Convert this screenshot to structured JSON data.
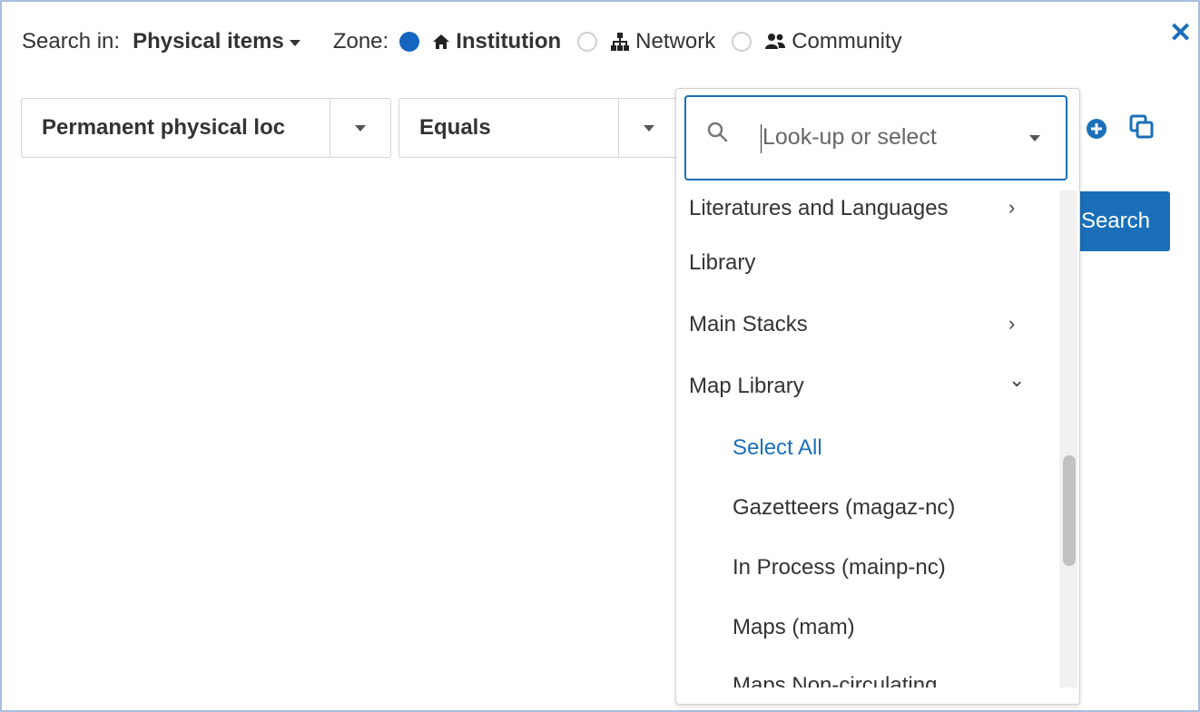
{
  "header": {
    "search_in_label": "Search in:",
    "search_scope": "Physical items",
    "zone_label": "Zone:",
    "zones": [
      {
        "label": "Institution",
        "selected": true,
        "icon": "home-icon"
      },
      {
        "label": "Network",
        "selected": false,
        "icon": "network-icon"
      },
      {
        "label": "Community",
        "selected": false,
        "icon": "community-icon"
      }
    ],
    "close_icon": "close-icon"
  },
  "filter": {
    "field": "Permanent physical loc",
    "operator": "Equals",
    "value_placeholder": "Look-up or select"
  },
  "actions": {
    "search_label": "Search"
  },
  "dropdown": {
    "items": [
      {
        "label": "Literatures and Languages",
        "chevron": "›"
      },
      {
        "label": "Library",
        "chevron": ""
      },
      {
        "label": "Main Stacks",
        "chevron": "›"
      },
      {
        "label": "Map Library",
        "chevron": "⌄"
      },
      {
        "label": "Select All",
        "chevron": ""
      },
      {
        "label": "Gazetteers (magaz-nc)",
        "chevron": ""
      },
      {
        "label": "In Process (mainp-nc)",
        "chevron": ""
      },
      {
        "label": "Maps (mam)",
        "chevron": ""
      },
      {
        "label": "Maps Non-circulating",
        "chevron": ""
      }
    ]
  },
  "colors": {
    "accent": "#1a6fb8",
    "frame_border": "#a8bde0"
  }
}
